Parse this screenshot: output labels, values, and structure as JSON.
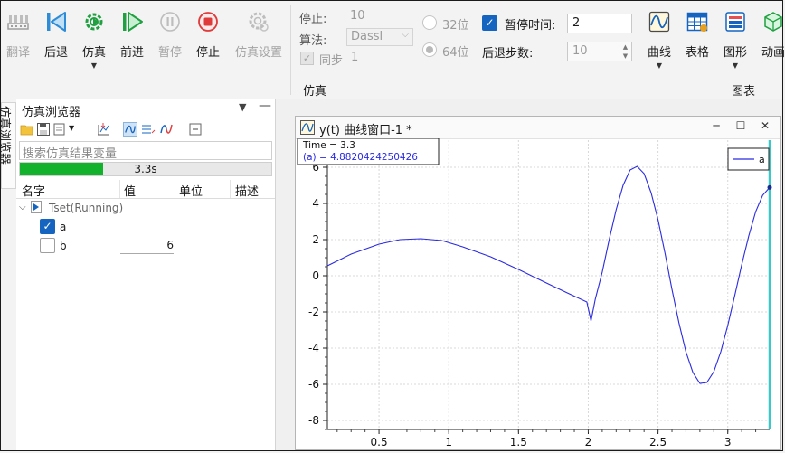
{
  "toolbar": {
    "translate": "翻译",
    "back": "后退",
    "simulate": "仿真",
    "forward": "前进",
    "pause": "暂停",
    "stop": "停止",
    "sim_settings": "仿真设置",
    "curve": "曲线",
    "table": "表格",
    "graphics": "图形",
    "animation": "动画"
  },
  "params": {
    "stop_label": "停止:",
    "stop_value": "10",
    "algo_label": "算法:",
    "algo_value": "Dassl",
    "sync_label": "同步",
    "sync_value": "1",
    "bit32": "32位",
    "bit64": "64位",
    "pause_time_label": "暂停时间:",
    "pause_time_value": "2",
    "back_steps_label": "后退步数:",
    "back_steps_value": "10"
  },
  "groups": {
    "simulation": "仿真",
    "chart": "图表"
  },
  "browser": {
    "vertical_tab": "仿真浏览器",
    "title": "仿真浏览器",
    "search_placeholder": "搜索仿真结果变量",
    "progress_text": "3.3s",
    "progress": 0.33,
    "columns": [
      "名字",
      "值",
      "单位",
      "描述"
    ],
    "root": "Tset(Running)",
    "var_a": "a",
    "var_b": "b",
    "var_b_value": "6"
  },
  "plot_window": {
    "title": "y(t) 曲线窗口-1 *",
    "tooltip_time": "Time = 3.3",
    "tooltip_value": "(a) = 4.8820424250426",
    "legend": "a"
  },
  "colors": {
    "accent": "#1565c0",
    "series": "#2a2ae0",
    "cursor": "#3cc8c8",
    "progress": "#12b22c"
  },
  "chart_data": {
    "type": "line",
    "x_ticks": [
      "0.5",
      "1",
      "1.5",
      "2",
      "2.5",
      "3"
    ],
    "y_ticks": [
      "6",
      "4",
      "2",
      "0",
      "-2",
      "-4",
      "-6",
      "-8"
    ],
    "xlim": [
      0.13,
      3.3
    ],
    "ylim": [
      -8.5,
      7.5
    ],
    "grid": true,
    "legend_position": "top-right",
    "cursor_x": 3.3,
    "series": [
      {
        "name": "a",
        "x": [
          0.13,
          0.3,
          0.5,
          0.65,
          0.8,
          0.95,
          1.1,
          1.3,
          1.5,
          1.7,
          1.85,
          1.99,
          2.02,
          2.05,
          2.1,
          2.15,
          2.2,
          2.25,
          2.3,
          2.35,
          2.4,
          2.45,
          2.5,
          2.55,
          2.6,
          2.65,
          2.7,
          2.75,
          2.8,
          2.85,
          2.9,
          2.95,
          3.0,
          3.05,
          3.1,
          3.15,
          3.2,
          3.25,
          3.3
        ],
        "y": [
          0.55,
          1.2,
          1.75,
          2.0,
          2.05,
          1.95,
          1.6,
          1.05,
          0.35,
          -0.4,
          -0.95,
          -1.45,
          -2.5,
          -1.3,
          0.2,
          2.0,
          3.65,
          5.0,
          5.85,
          6.05,
          5.65,
          4.6,
          3.1,
          1.25,
          -0.75,
          -2.6,
          -4.2,
          -5.35,
          -5.95,
          -5.9,
          -5.3,
          -4.2,
          -2.75,
          -1.1,
          0.6,
          2.2,
          3.55,
          4.45,
          4.88
        ]
      }
    ]
  }
}
